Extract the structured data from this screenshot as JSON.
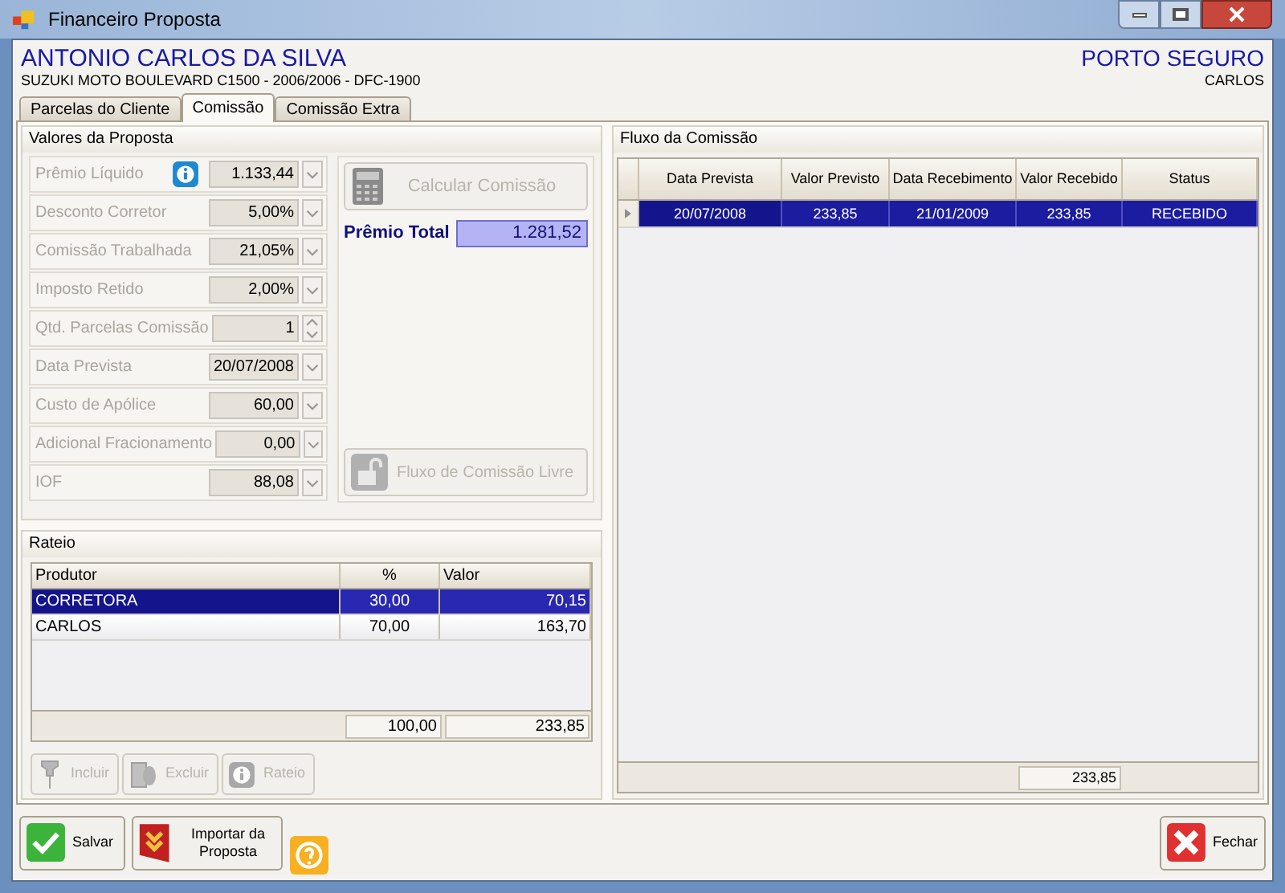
{
  "window": {
    "title": "Financeiro Proposta"
  },
  "header": {
    "client": "ANTONIO CARLOS DA SILVA",
    "vehicle": "SUZUKI MOTO BOULEVARD C1500 - 2006/2006 - DFC-1900",
    "insurer": "PORTO SEGURO",
    "user": "CARLOS"
  },
  "tabs": [
    {
      "label": "Parcelas do Cliente",
      "selected": false
    },
    {
      "label": "Comissão",
      "selected": true
    },
    {
      "label": "Comissão Extra",
      "selected": false
    }
  ],
  "valores": {
    "title": "Valores da Proposta",
    "fields": [
      {
        "label": "Prêmio Líquido",
        "value": "1.133,44",
        "kind": "combo",
        "info": true
      },
      {
        "label": "Desconto Corretor",
        "value": "5,00%",
        "kind": "combo",
        "info": false
      },
      {
        "label": "Comissão Trabalhada",
        "value": "21,05%",
        "kind": "combo",
        "info": false
      },
      {
        "label": "Imposto Retido",
        "value": "2,00%",
        "kind": "combo",
        "info": false
      },
      {
        "label": "Qtd. Parcelas Comissão",
        "value": "1",
        "kind": "spin",
        "info": false
      },
      {
        "label": "Data Prevista",
        "value": "20/07/2008",
        "kind": "combo",
        "info": false
      },
      {
        "label": "Custo de Apólice",
        "value": "60,00",
        "kind": "combo",
        "info": false
      },
      {
        "label": "Adicional Fracionamento",
        "value": "0,00",
        "kind": "combo",
        "info": false
      },
      {
        "label": "IOF",
        "value": "88,08",
        "kind": "combo",
        "info": false
      }
    ],
    "calc_button": {
      "label": "Calcular Comissão",
      "disabled": true
    },
    "total_label": "Prêmio Total",
    "total_value": "1.281,52",
    "flow_button": {
      "label": "Fluxo de Comissão Livre",
      "disabled": true
    }
  },
  "rateio": {
    "title": "Rateio",
    "columns": [
      "Produtor",
      "%",
      "Valor"
    ],
    "rows": [
      {
        "cells": [
          "CORRETORA",
          "30,00",
          "70,15"
        ],
        "selected": true
      },
      {
        "cells": [
          "CARLOS",
          "70,00",
          "163,70"
        ],
        "selected": false
      }
    ],
    "totals": [
      "100,00",
      "233,85"
    ],
    "buttons": [
      {
        "label": "Incluir",
        "disabled": true
      },
      {
        "label": "Excluir",
        "disabled": true
      },
      {
        "label": "Rateio",
        "disabled": true
      }
    ]
  },
  "fluxo": {
    "title": "Fluxo da Comissão",
    "columns": [
      "Data Prevista",
      "Valor Previsto",
      "Data Recebimento",
      "Valor Recebido",
      "Status"
    ],
    "rows": [
      {
        "cells": [
          "20/07/2008",
          "233,85",
          "21/01/2009",
          "233,85",
          "RECEBIDO"
        ],
        "selected": true
      }
    ],
    "total": "233,85"
  },
  "footer": {
    "save": "Salvar",
    "import": "Importar da Proposta",
    "close": "Fechar"
  }
}
